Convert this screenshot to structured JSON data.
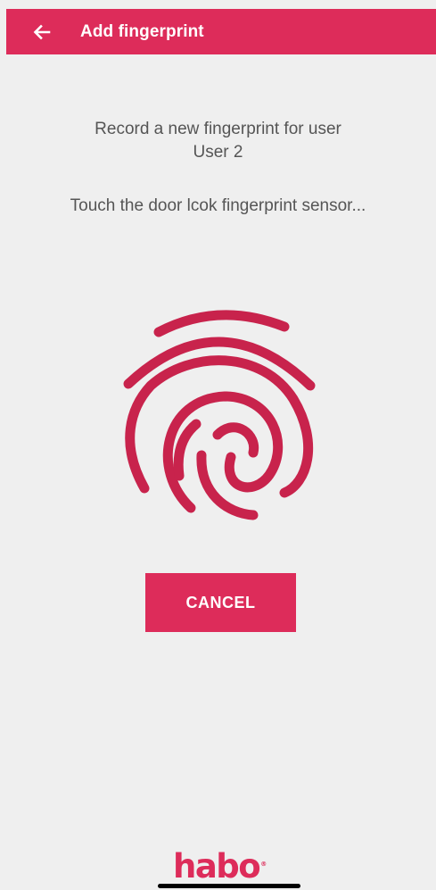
{
  "app_bar": {
    "title": "Add fingerprint",
    "back_icon": "arrow-left-icon",
    "color": "#dd2c5a"
  },
  "prompt": {
    "line1": "Record a new fingerprint for user",
    "user_name": "User 2",
    "instruction": "Touch the door lcok fingerprint sensor..."
  },
  "fingerprint": {
    "icon": "fingerprint-icon",
    "color": "#c8234c"
  },
  "cancel_button": {
    "label": "CANCEL"
  },
  "brand": {
    "logo_text": "habo",
    "registered_mark": "®"
  },
  "colors": {
    "accent": "#dd2c5a",
    "background": "#efefef",
    "text": "#555555"
  }
}
